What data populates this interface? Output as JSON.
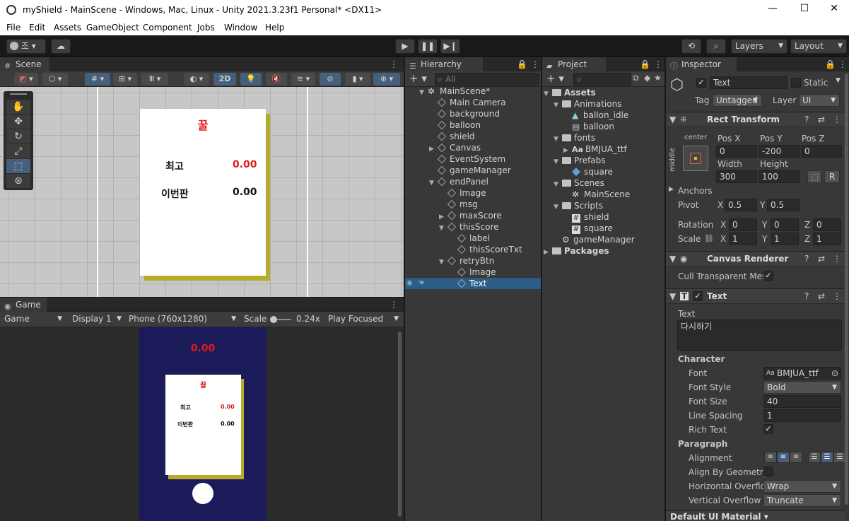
{
  "window": {
    "title": "myShield - MainScene - Windows, Mac, Linux - Unity 2021.3.23f1 Personal* <DX11>",
    "minimize": "—",
    "maximize": "☐",
    "close": "✕"
  },
  "menu": [
    "File",
    "Edit",
    "Assets",
    "GameObject",
    "Component",
    "Jobs",
    "Window",
    "Help"
  ],
  "toolbar": {
    "account_label": "조",
    "layers_label": "Layers",
    "layout_label": "Layout"
  },
  "scene": {
    "tab_label": "Scene",
    "mode_2d": "2D",
    "panel_title": "꿀",
    "best_label": "최고",
    "best_value": "0.00",
    "this_label": "이번판",
    "this_value": "0.00"
  },
  "game": {
    "tab_label": "Game",
    "mode_dropdown": "Game",
    "display_dropdown": "Display 1",
    "resolution_dropdown": "Phone (760x1280)",
    "scale_label": "Scale",
    "scale_value": "0.24x",
    "play_mode_dropdown": "Play Focused",
    "score_value": "0.00",
    "panel_title": "꿀",
    "best_label": "최고",
    "best_value": "0.00",
    "this_label": "이번판",
    "this_value": "0.00"
  },
  "hierarchy": {
    "tab_label": "Hierarchy",
    "search_placeholder": "All",
    "items": [
      {
        "label": "MainScene*",
        "depth": 0,
        "fold": "open",
        "icon": "unity-scene-icon"
      },
      {
        "label": "Main Camera",
        "depth": 1,
        "fold": "none",
        "icon": "cube-icon"
      },
      {
        "label": "background",
        "depth": 1,
        "fold": "none",
        "icon": "cube-icon"
      },
      {
        "label": "balloon",
        "depth": 1,
        "fold": "none",
        "icon": "cube-icon"
      },
      {
        "label": "shield",
        "depth": 1,
        "fold": "none",
        "icon": "cube-icon"
      },
      {
        "label": "Canvas",
        "depth": 1,
        "fold": "closed",
        "icon": "cube-icon"
      },
      {
        "label": "EventSystem",
        "depth": 1,
        "fold": "none",
        "icon": "cube-icon"
      },
      {
        "label": "gameManager",
        "depth": 1,
        "fold": "none",
        "icon": "cube-icon"
      },
      {
        "label": "endPanel",
        "depth": 1,
        "fold": "open",
        "icon": "cube-icon"
      },
      {
        "label": "Image",
        "depth": 2,
        "fold": "none",
        "icon": "cube-icon"
      },
      {
        "label": "msg",
        "depth": 2,
        "fold": "none",
        "icon": "cube-icon"
      },
      {
        "label": "maxScore",
        "depth": 2,
        "fold": "closed",
        "icon": "cube-icon"
      },
      {
        "label": "thisScore",
        "depth": 2,
        "fold": "open",
        "icon": "cube-icon"
      },
      {
        "label": "label",
        "depth": 3,
        "fold": "none",
        "icon": "cube-icon"
      },
      {
        "label": "thisScoreTxt",
        "depth": 3,
        "fold": "none",
        "icon": "cube-icon"
      },
      {
        "label": "retryBtn",
        "depth": 2,
        "fold": "open",
        "icon": "cube-icon"
      },
      {
        "label": "Image",
        "depth": 3,
        "fold": "none",
        "icon": "cube-icon"
      },
      {
        "label": "Text",
        "depth": 3,
        "fold": "none",
        "icon": "cube-icon",
        "selected": true
      }
    ]
  },
  "project": {
    "tab_label": "Project",
    "items": [
      {
        "label": "Assets",
        "depth": 0,
        "fold": "open",
        "icon": "folder-icon",
        "bold": true
      },
      {
        "label": "Animations",
        "depth": 1,
        "fold": "open",
        "icon": "folder-icon"
      },
      {
        "label": "ballon_idle",
        "depth": 2,
        "fold": "none",
        "icon": "animation-clip-icon"
      },
      {
        "label": "balloon",
        "depth": 2,
        "fold": "none",
        "icon": "animator-controller-icon"
      },
      {
        "label": "fonts",
        "depth": 1,
        "fold": "open",
        "icon": "folder-icon"
      },
      {
        "label": "BMJUA_ttf",
        "depth": 2,
        "fold": "closed",
        "icon": "font-icon"
      },
      {
        "label": "Prefabs",
        "depth": 1,
        "fold": "open",
        "icon": "folder-icon"
      },
      {
        "label": "square",
        "depth": 2,
        "fold": "none",
        "icon": "prefab-icon"
      },
      {
        "label": "Scenes",
        "depth": 1,
        "fold": "open",
        "icon": "folder-icon"
      },
      {
        "label": "MainScene",
        "depth": 2,
        "fold": "none",
        "icon": "unity-scene-icon"
      },
      {
        "label": "Scripts",
        "depth": 1,
        "fold": "open",
        "icon": "folder-icon"
      },
      {
        "label": "shield",
        "depth": 2,
        "fold": "none",
        "icon": "script-icon"
      },
      {
        "label": "square",
        "depth": 2,
        "fold": "none",
        "icon": "script-icon"
      },
      {
        "label": "gameManager",
        "depth": 1,
        "fold": "none",
        "icon": "gear-icon"
      },
      {
        "label": "Packages",
        "depth": 0,
        "fold": "closed",
        "icon": "folder-icon",
        "bold": true
      }
    ]
  },
  "inspector": {
    "tab_label": "Inspector",
    "object_name": "Text",
    "static_label": "Static",
    "tag_label": "Tag",
    "tag_value": "Untagged",
    "layer_label": "Layer",
    "layer_value": "UI",
    "rect_transform": {
      "title": "Rect Transform",
      "anchor_h": "center",
      "anchor_v": "middle",
      "posx_label": "Pos X",
      "posy_label": "Pos Y",
      "posz_label": "Pos Z",
      "posx": "0",
      "posy": "-200",
      "posz": "0",
      "width_label": "Width",
      "height_label": "Height",
      "width": "300",
      "height": "100",
      "raw_btn": "R",
      "anchors_label": "Anchors",
      "pivot_label": "Pivot",
      "pivot_x": "0.5",
      "pivot_y": "0.5",
      "rotation_label": "Rotation",
      "rot_x": "0",
      "rot_y": "0",
      "rot_z": "0",
      "scale_label": "Scale",
      "scale_x": "1",
      "scale_y": "1",
      "scale_z": "1",
      "x": "X",
      "y": "Y",
      "z": "Z"
    },
    "canvas_renderer": {
      "title": "Canvas Renderer",
      "cull_label": "Cull Transparent Mes"
    },
    "text_component": {
      "title": "Text",
      "text_label": "Text",
      "text_value": "다시하기",
      "character_label": "Character",
      "font_label": "Font",
      "font_value": "BMJUA_ttf",
      "font_style_label": "Font Style",
      "font_style_value": "Bold",
      "font_size_label": "Font Size",
      "font_size_value": "40",
      "line_spacing_label": "Line Spacing",
      "line_spacing_value": "1",
      "rich_text_label": "Rich Text",
      "paragraph_label": "Paragraph",
      "alignment_label": "Alignment",
      "align_geom_label": "Align By Geometry",
      "h_overflow_label": "Horizontal Overflo",
      "h_overflow_value": "Wrap",
      "v_overflow_label": "Vertical Overflow",
      "v_overflow_value": "Truncate"
    },
    "material_label": "Default UI Material"
  }
}
